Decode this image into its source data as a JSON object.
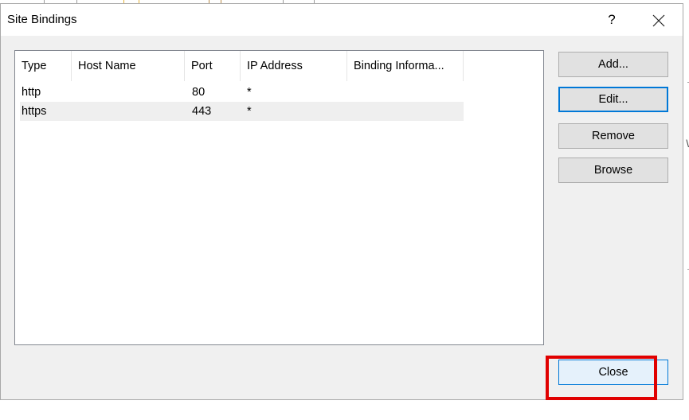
{
  "dialog": {
    "title": "Site Bindings",
    "help_label": "?",
    "close_label": "✕"
  },
  "bindings": {
    "columns": [
      "Type",
      "Host Name",
      "Port",
      "IP Address",
      "Binding Informa..."
    ],
    "rows": [
      {
        "type": "http",
        "host": "",
        "port": "80",
        "ip": "*",
        "info": ""
      },
      {
        "type": "https",
        "host": "",
        "port": "443",
        "ip": "*",
        "info": ""
      }
    ]
  },
  "buttons": {
    "add": "Add...",
    "edit": "Edit...",
    "remove": "Remove",
    "browse": "Browse",
    "close": "Close"
  },
  "background": {
    "right_glyph": "\\"
  },
  "colors": {
    "accent": "#0078d7",
    "highlight": "#e00000",
    "selected_row": "#efefef"
  }
}
